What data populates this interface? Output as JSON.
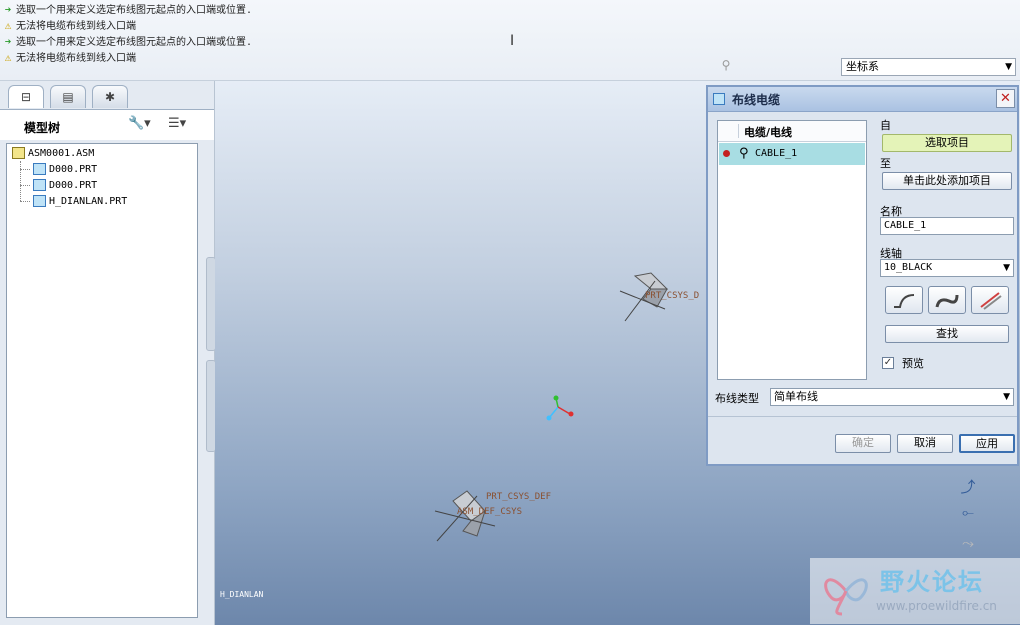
{
  "messages": [
    {
      "type": "prompt",
      "text": "选取一个用来定义选定布线图元起点的入口端或位置."
    },
    {
      "type": "warning",
      "text": "无法将电缆布线到线入口端"
    },
    {
      "type": "prompt",
      "text": "选取一个用来定义选定布线图元起点的入口端或位置."
    },
    {
      "type": "warning",
      "text": "无法将电缆布线到线入口端"
    }
  ],
  "filter": {
    "value": "坐标系"
  },
  "model_tree": {
    "title": "模型树",
    "items": [
      {
        "label": "ASM0001.ASM",
        "type": "assembly"
      },
      {
        "label": "D000.PRT",
        "type": "part"
      },
      {
        "label": "D000.PRT",
        "type": "part"
      },
      {
        "label": "H_DIANLAN.PRT",
        "type": "part"
      }
    ]
  },
  "viewport": {
    "labels": [
      "PRT_CSYS_D",
      "PRT_CSYS_DEF",
      "ASM_DEF_CSYS"
    ],
    "bottom_label": "H_DIANLAN"
  },
  "dialog": {
    "title": "布线电缆",
    "list_header": "电缆/电线",
    "list_items": [
      "CABLE_1"
    ],
    "from_label": "自",
    "from_button": "选取项目",
    "to_label": "至",
    "to_button": "单击此处添加项目",
    "name_label": "名称",
    "name_value": "CABLE_1",
    "spool_label": "线轴",
    "spool_value": "10_BLACK",
    "find_button": "查找",
    "preview_label": "预览",
    "preview_checked": true,
    "route_type_label": "布线类型",
    "route_type_value": "简单布线",
    "ok_button": "确定",
    "cancel_button": "取消",
    "apply_button": "应用"
  },
  "watermark": {
    "text": "野火论坛",
    "url": "www.proewildfire.cn"
  }
}
